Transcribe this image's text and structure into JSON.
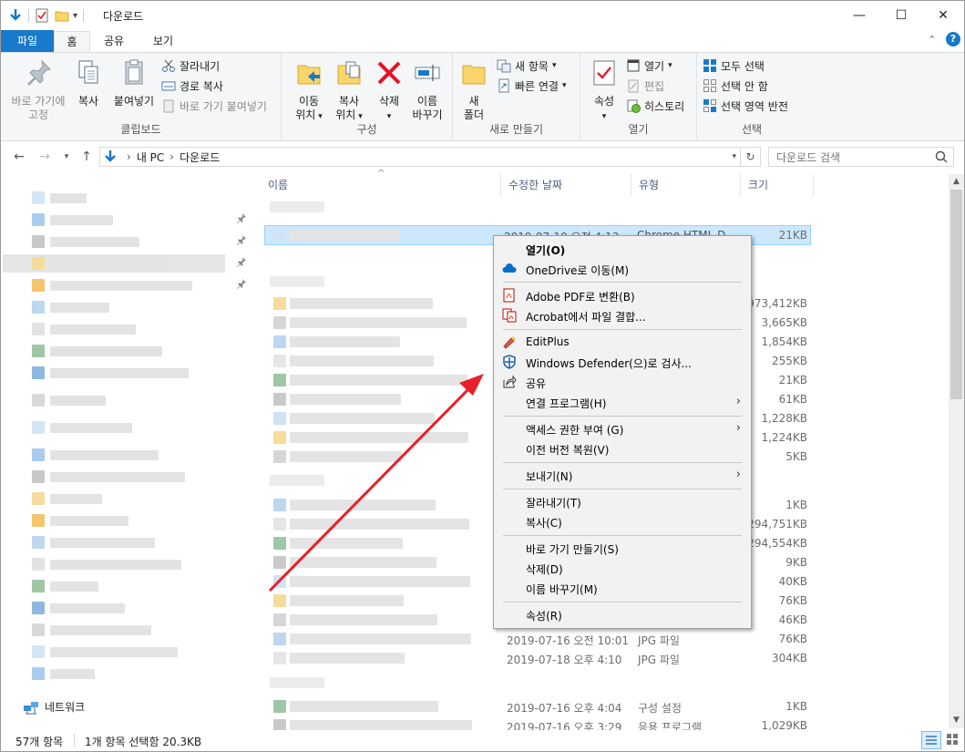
{
  "window": {
    "title": "다운로드",
    "minimize": "—",
    "maximize": "☐",
    "close": "✕"
  },
  "tabs": {
    "file": "파일",
    "home": "홈",
    "share": "공유",
    "view": "보기"
  },
  "ribbon": {
    "clipboard": {
      "label": "클립보드",
      "pin_line1": "바로 가기에",
      "pin_line2": "고정",
      "copy": "복사",
      "paste": "붙여넣기",
      "cut": "잘라내기",
      "copy_path": "경로 복사",
      "paste_shortcut": "바로 가기 붙여넣기"
    },
    "organize": {
      "label": "구성",
      "move_line1": "이동",
      "move_line2": "위치",
      "copyto_line1": "복사",
      "copyto_line2": "위치",
      "delete": "삭제",
      "rename_line1": "이름",
      "rename_line2": "바꾸기"
    },
    "new": {
      "label": "새로 만들기",
      "folder_line1": "새",
      "folder_line2": "폴더",
      "new_item": "새 항목",
      "easy_access": "빠른 연결"
    },
    "open": {
      "label": "열기",
      "properties": "속성",
      "open": "열기",
      "edit": "편집",
      "history": "히스토리"
    },
    "select": {
      "label": "선택",
      "select_all": "모두 선택",
      "select_none": "선택 안 함",
      "invert": "선택 영역 반전"
    }
  },
  "address": {
    "pc": "내 PC",
    "folder": "다운로드",
    "search_placeholder": "다운로드 검색"
  },
  "columns": {
    "name": "이름",
    "date": "수정한 날짜",
    "type": "유형",
    "size": "크기"
  },
  "rows": [
    {
      "size": "21KB"
    },
    {
      "size": "973,412KB"
    },
    {
      "size": "3,665KB"
    },
    {
      "size": "1,854KB"
    },
    {
      "size": "255KB"
    },
    {
      "size": "21KB"
    },
    {
      "size": "61KB"
    },
    {
      "size": "1,228KB"
    },
    {
      "size": "1,224KB"
    },
    {
      "size": "5KB"
    },
    {
      "size": "1KB"
    },
    {
      "size": "294,751KB"
    },
    {
      "size": "294,554KB"
    },
    {
      "size": "9KB"
    },
    {
      "size": "40KB"
    },
    {
      "size": "76KB"
    },
    {
      "size": "46KB"
    },
    {
      "date": "2019-07-16 오전 10:01",
      "type": "JPG 파일",
      "size": "76KB"
    },
    {
      "date": "2019-07-18 오후 4:10",
      "type": "JPG 파일",
      "size": "304KB"
    },
    {
      "date": "2019-07-16 오후 4:04",
      "type": "구성 설정",
      "size": "1KB"
    },
    {
      "date": "2019-07-16 오후 3:29",
      "type": "응용 프로그램",
      "size": "1,029KB"
    }
  ],
  "selected_row": {
    "date": "2019-07-19 오전 4:13",
    "type": "Chrome HTML D..."
  },
  "nav": {
    "network": "네트워크"
  },
  "context_menu": {
    "open": "열기(O)",
    "onedrive": "OneDrive로 이동(M)",
    "adobe_pdf": "Adobe PDF로 변환(B)",
    "acrobat_combine": "Acrobat에서 파일 결합...",
    "editplus": "EditPlus",
    "defender": "Windows Defender(으)로 검사...",
    "share": "공유",
    "open_with": "연결 프로그램(H)",
    "give_access": "액세스 권한 부여 (G)",
    "restore_prev": "이전 버전 복원(V)",
    "send_to": "보내기(N)",
    "cut": "잘라내기(T)",
    "copy": "복사(C)",
    "create_shortcut": "바로 가기 만들기(S)",
    "delete": "삭제(D)",
    "rename": "이름 바꾸기(M)",
    "properties": "속성(R)"
  },
  "status": {
    "count": "57개 항목",
    "selection": "1개 항목 선택함 20.3KB"
  },
  "colors": {
    "accent": "#1979ca",
    "selection": "#cce8ff",
    "arrow": "#e8202a"
  }
}
